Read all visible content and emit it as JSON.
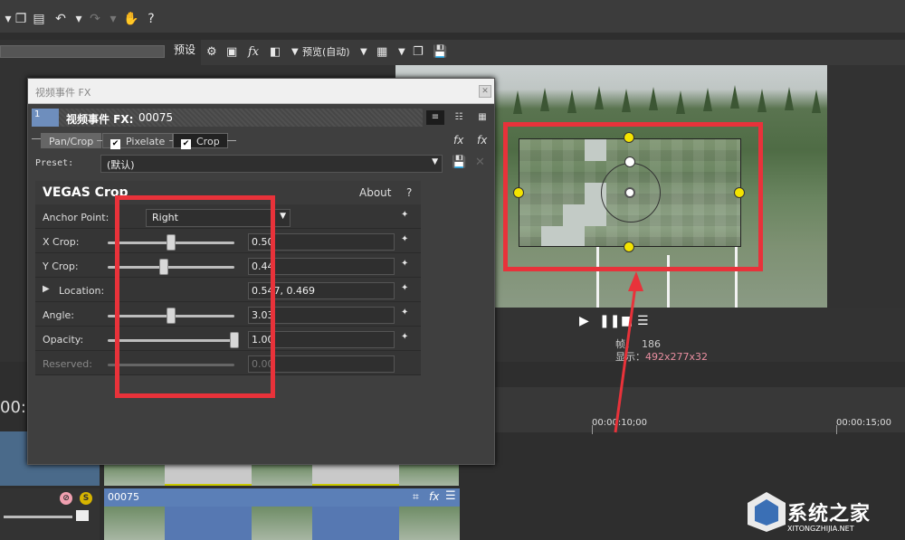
{
  "app": {
    "preview_menu_label": "预设",
    "preview_mode": "预览(自动)"
  },
  "fx_window": {
    "title": "视频事件 FX",
    "header_label": "视频事件 FX:",
    "event_number": "00075",
    "chain": [
      {
        "label": "Pan/Crop",
        "checked": false
      },
      {
        "label": "Pixelate",
        "checked": true
      },
      {
        "label": "Crop",
        "checked": true
      }
    ],
    "preset_label": "Preset:",
    "preset_value": "(默认)",
    "plugin": {
      "title": "VEGAS Crop",
      "about": "About",
      "help": "?",
      "params": [
        {
          "label": "Anchor Point:",
          "kind": "select",
          "value": "Right"
        },
        {
          "label": "X Crop:",
          "kind": "slider",
          "value": "0.50",
          "level": 0.5
        },
        {
          "label": "Y Crop:",
          "kind": "slider",
          "value": "0.44",
          "level": 0.44
        },
        {
          "label": "Location:",
          "kind": "expand",
          "value": "0.547, 0.469"
        },
        {
          "label": "Angle:",
          "kind": "slider",
          "value": "3.03",
          "level": 0.5
        },
        {
          "label": "Opacity:",
          "kind": "slider",
          "value": "1.00",
          "level": 1.0
        },
        {
          "label": "Reserved:",
          "kind": "slider-disabled",
          "value": "0.00",
          "level": 0.0
        }
      ]
    }
  },
  "preview": {
    "frame_label": "帧：",
    "frame_value": "186",
    "display_label": "显示：",
    "display_value": "492x277x32"
  },
  "timeline": {
    "timecode": "00:",
    "ruler": [
      "00:00:10;00",
      "00:00:15;00"
    ],
    "clip_name": "00075"
  },
  "watermark": {
    "title": "系统之家",
    "subtitle": "XITONGZHIJIA.NET"
  },
  "colors": {
    "annotation_red": "#e8323a",
    "handle_yellow": "#f4e400",
    "clip_blue": "#5b7fb7"
  }
}
